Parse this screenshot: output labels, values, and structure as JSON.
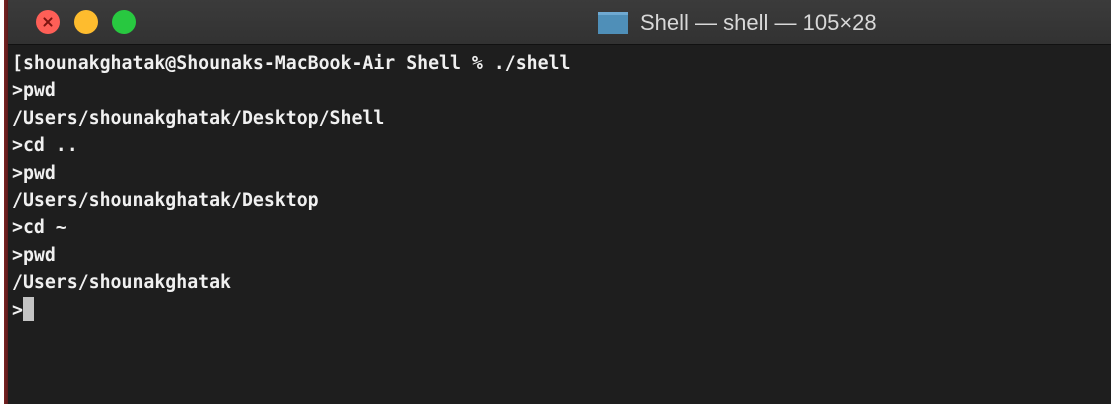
{
  "window": {
    "title": "Shell — shell — 105×28",
    "colors": {
      "background": "#1e1e1e",
      "text": "#f0f0f0",
      "titlebar": "#353535",
      "close": "#fe5f57",
      "minimize": "#febc2e",
      "zoom": "#28c840"
    },
    "buttons": {
      "close": "close-button",
      "minimize": "minimize-button",
      "zoom": "zoom-button"
    },
    "title_icon": "folder-icon"
  },
  "terminal": {
    "lines": [
      "[shounakghatak@Shounaks-MacBook-Air Shell % ./shell",
      ">pwd",
      "/Users/shounakghatak/Desktop/Shell",
      ">cd ..",
      ">pwd",
      "/Users/shounakghatak/Desktop",
      ">cd ~",
      ">pwd",
      "/Users/shounakghatak"
    ],
    "prompt": ">",
    "cursor": "block-cursor"
  }
}
